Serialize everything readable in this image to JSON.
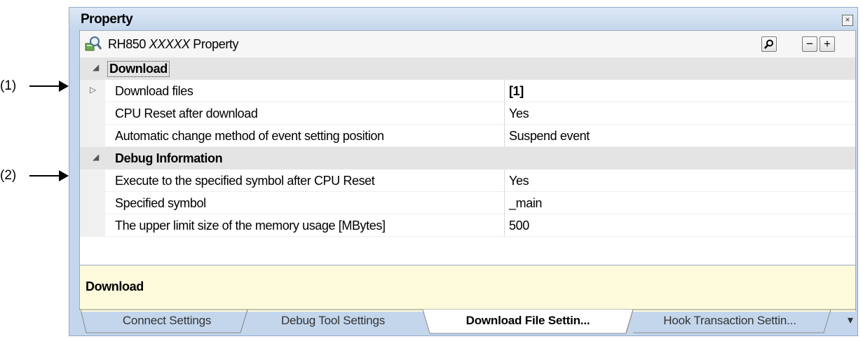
{
  "callouts": [
    {
      "label": "(1)"
    },
    {
      "label": "(2)"
    }
  ],
  "panel": {
    "title": "Property",
    "close_glyph": "×"
  },
  "header": {
    "icon": "property-magnifier-icon",
    "title_prefix": "RH850",
    "title_italic": "XXXXX",
    "title_suffix": "Property",
    "search_glyph": "⚲",
    "collapse_glyph": "−",
    "expand_glyph": "+"
  },
  "categories": [
    {
      "name": "Download",
      "properties": [
        {
          "name": "Download files",
          "value": "[1]",
          "expandable": true
        },
        {
          "name": "CPU Reset after download",
          "value": "Yes"
        },
        {
          "name": "Automatic change method of event setting position",
          "value": "Suspend event"
        }
      ]
    },
    {
      "name": "Debug Information",
      "properties": [
        {
          "name": "Execute to the specified symbol after CPU Reset",
          "value": "Yes"
        },
        {
          "name": "Specified symbol",
          "value": "_main"
        },
        {
          "name": "The upper limit size of the memory usage [MBytes]",
          "value": "500"
        }
      ]
    }
  ],
  "description": {
    "text": "Download"
  },
  "tabs": [
    {
      "label": "Connect Settings",
      "active": false
    },
    {
      "label": "Debug Tool Settings",
      "active": false
    },
    {
      "label": "Download File Settin...",
      "active": true
    },
    {
      "label": "Hook Transaction Settin...",
      "active": false
    }
  ],
  "tab_overflow_glyph": "▾",
  "colors": {
    "panel_bg": "#c3d6ec",
    "category_bg": "#e4e4e4",
    "description_bg": "#fdfbdc"
  }
}
